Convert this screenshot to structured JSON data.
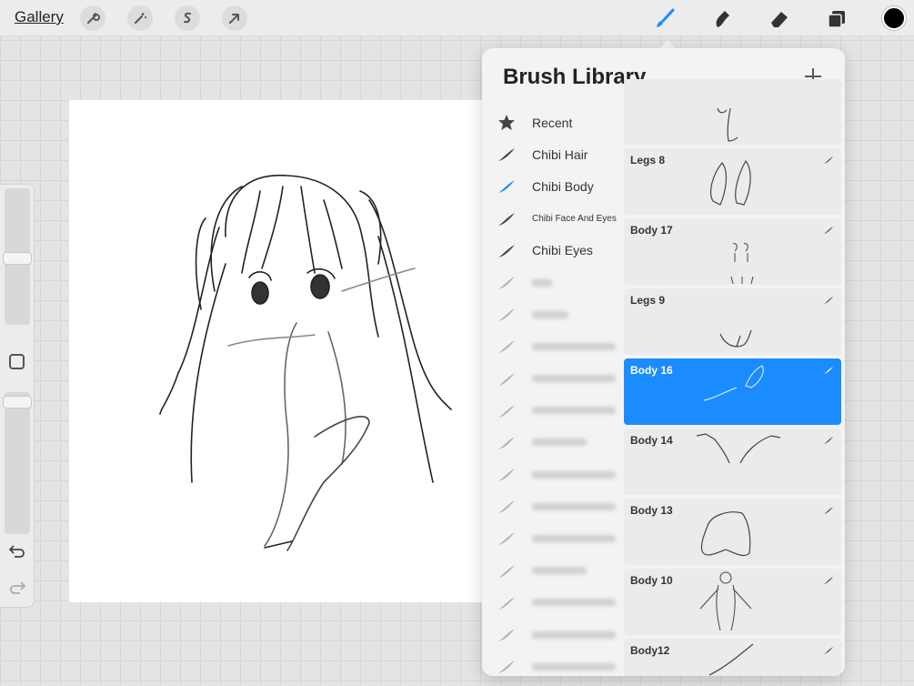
{
  "toolbar": {
    "gallery_label": "Gallery",
    "left_tools": [
      "wrench-icon",
      "magic-wand-icon",
      "selection-icon",
      "move-arrow-icon"
    ],
    "right_tools": [
      "brush-icon",
      "smudge-icon",
      "eraser-icon",
      "layers-icon"
    ],
    "active_tool": "brush-icon",
    "active_color": "#000000",
    "accent": "#1a8cff"
  },
  "panel": {
    "title": "Brush Library",
    "add_label": "+",
    "sets": [
      {
        "label": "Recent",
        "icon": "star-icon"
      },
      {
        "label": "Chibi Hair",
        "icon": "brush-stroke-icon"
      },
      {
        "label": "Chibi Body",
        "icon": "brush-stroke-icon",
        "active": true
      },
      {
        "label": "Chibi Face And Eyes",
        "icon": "brush-stroke-icon"
      },
      {
        "label": "Chibi Eyes",
        "icon": "brush-stroke-icon"
      }
    ],
    "brushes": [
      {
        "name": ""
      },
      {
        "name": "Legs 8"
      },
      {
        "name": "Body 17"
      },
      {
        "name": "Legs 9"
      },
      {
        "name": "Body 16",
        "selected": true
      },
      {
        "name": "Body 14"
      },
      {
        "name": "Body 13"
      },
      {
        "name": "Body 10"
      },
      {
        "name": "Body12"
      }
    ]
  }
}
